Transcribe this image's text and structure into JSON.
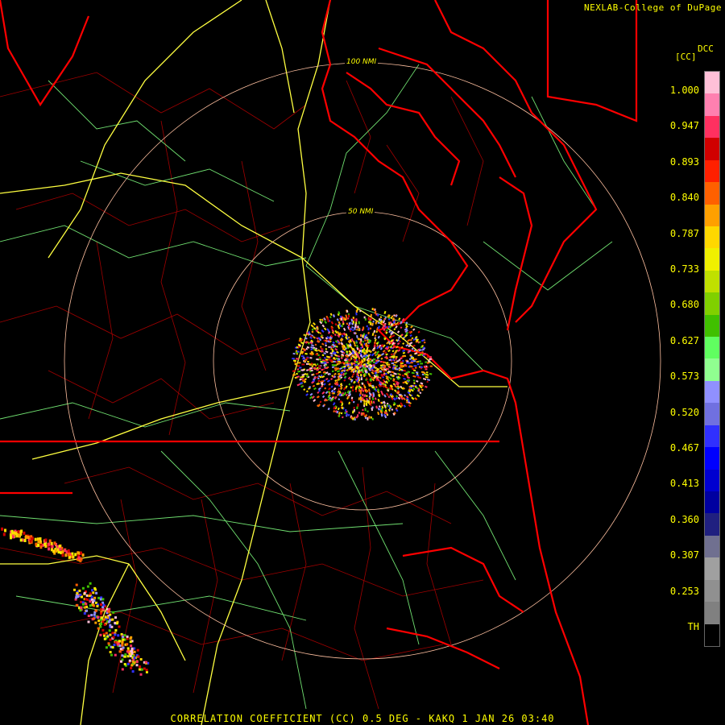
{
  "header": {
    "credit": "NEXLAB-College of DuPage"
  },
  "range_rings": [
    {
      "label": "100 NMI"
    },
    {
      "label": "50 NMI"
    }
  ],
  "legend": {
    "units": "[CC]",
    "product": "DCC",
    "ticks": [
      "1.000",
      "0.947",
      "0.893",
      "0.840",
      "0.787",
      "0.733",
      "0.680",
      "0.627",
      "0.573",
      "0.520",
      "0.467",
      "0.413",
      "0.360",
      "0.307",
      "0.253",
      "TH"
    ],
    "colors": [
      "#ffc0d8",
      "#ff80b0",
      "#ff3060",
      "#d00000",
      "#ff2000",
      "#ff6000",
      "#ffa000",
      "#ffd800",
      "#f0f000",
      "#c0e000",
      "#80d000",
      "#40c000",
      "#60ff60",
      "#90ff90",
      "#9090ff",
      "#7070e0",
      "#3030ff",
      "#0000ff",
      "#0000d0",
      "#0000a0",
      "#202080",
      "#707090",
      "#a0a0a0",
      "#909090",
      "#808080"
    ]
  },
  "footer": {
    "caption": "CORRELATION COEFFICIENT (CC) 0.5 DEG - KAKQ 1 JAN 26 03:40"
  },
  "map": {
    "radar_site": "KAKQ",
    "colors": {
      "state_borders": "#ff0000",
      "coastline": "#ff0000",
      "county_lines": "#a00000",
      "roads": "#ffff40",
      "minor_roads": "#80ff80",
      "rings": "#ffc0a0",
      "text": "#ffff00"
    }
  }
}
